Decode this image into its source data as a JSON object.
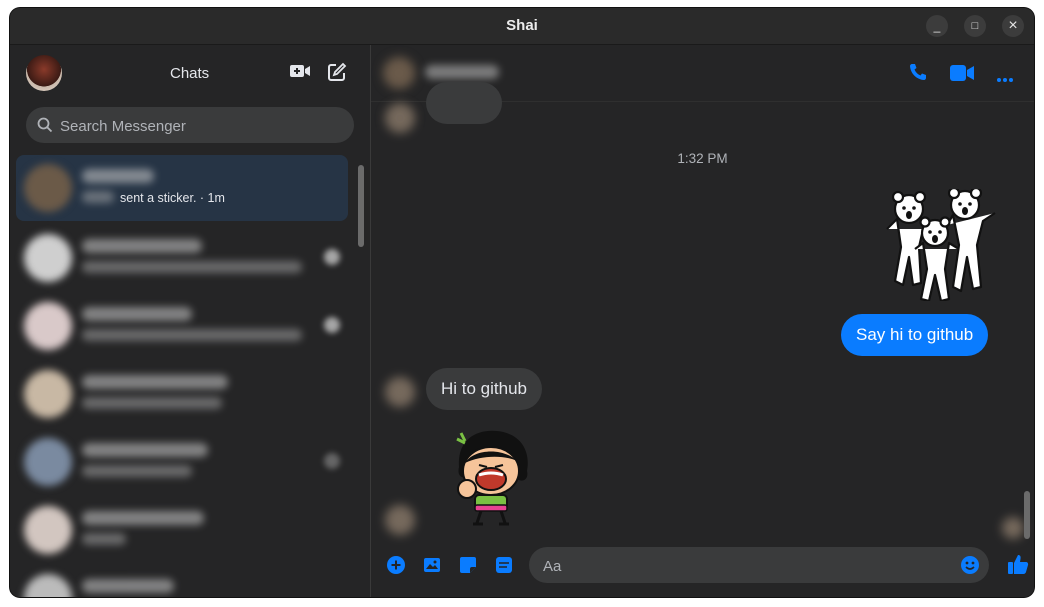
{
  "window": {
    "title": "Shai"
  },
  "titlebar_buttons": {
    "minimize": "_",
    "maximize": "□",
    "close": "×"
  },
  "sidebar": {
    "title": "Chats",
    "search_placeholder": "Search Messenger",
    "conversations": [
      {
        "preview": "sent a sticker. · 1m",
        "active": true,
        "avatar_color": "#6b5a48"
      },
      {
        "preview": "",
        "active": false,
        "avatar_color": "#cfcfcf"
      },
      {
        "preview": "",
        "active": false,
        "avatar_color": "#d9c9c9"
      },
      {
        "preview": "",
        "active": false,
        "avatar_color": "#c8b8a4"
      },
      {
        "preview": "",
        "active": false,
        "avatar_color": "#7a8aa0"
      },
      {
        "preview": "",
        "active": false,
        "avatar_color": "#d2c6c0"
      },
      {
        "preview": "",
        "active": false,
        "avatar_color": "#bbbbbb"
      }
    ]
  },
  "chat": {
    "timestamp": "1:32 PM",
    "messages": [
      {
        "from": "me",
        "type": "sticker",
        "name": "three-bears-sticker"
      },
      {
        "from": "me",
        "type": "text",
        "text": "Say hi to github"
      },
      {
        "from": "them",
        "type": "text",
        "text": "Hi to github"
      },
      {
        "from": "them",
        "type": "sticker",
        "name": "laughing-girl-sticker"
      }
    ],
    "composer_placeholder": "Aa"
  },
  "colors": {
    "accent": "#0a7cff",
    "background": "#252526",
    "bubble_in": "#3a3b3c",
    "active_conversation": "#263445"
  },
  "icons": {
    "sidebar": [
      "new-video-call-icon",
      "compose-icon",
      "search-icon"
    ],
    "header": [
      "phone-icon",
      "video-camera-icon",
      "more-icon"
    ],
    "composer": [
      "plus-circle-icon",
      "image-icon",
      "sticker-icon",
      "gif-icon",
      "emoji-icon",
      "thumbs-up-icon"
    ]
  }
}
